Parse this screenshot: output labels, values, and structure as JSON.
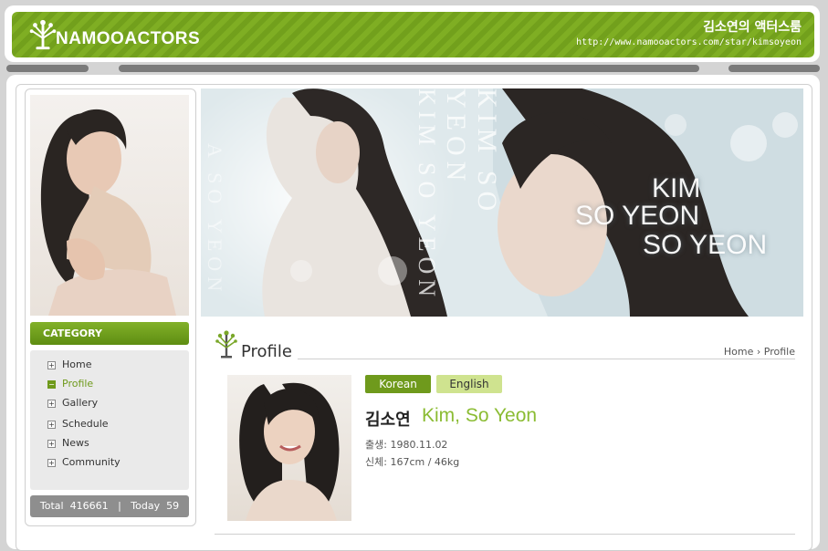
{
  "header": {
    "logo_text": "NAMOOACTORS",
    "site_title": "김소연의 액터스룸",
    "site_url": "http://www.namooactors.com/star/kimsoyeon",
    "logo_icon": "tree-icon"
  },
  "sidebar": {
    "category_title": "CATEGORY",
    "menu": [
      {
        "label": "Home",
        "active": false
      },
      {
        "label": "Profile",
        "active": true
      },
      {
        "label": "Gallery",
        "active": false
      },
      {
        "label": "Schedule",
        "active": false
      },
      {
        "label": "News",
        "active": false
      },
      {
        "label": "Community",
        "active": false
      }
    ],
    "counter": {
      "total_label": "Total",
      "total_value": "416661",
      "today_label": "Today",
      "today_value": "59"
    }
  },
  "banner": {
    "vertical_text": "KIM SO YEON",
    "vertical_text_2": "A SO YEON",
    "word_1": "KIM",
    "word_2": "SO YEON",
    "word_3": "SO YEON"
  },
  "profile": {
    "heading": "Profile",
    "breadcrumb": {
      "home": "Home",
      "separator": "›",
      "current": "Profile"
    },
    "lang_korean": "Korean",
    "lang_english": "English",
    "name_ko": "김소연",
    "name_en": "Kim, So Yeon",
    "birth_label": "출생:",
    "birth_value": "1980.11.02",
    "body_label": "신체:",
    "body_value": "167cm / 46kg"
  },
  "colors": {
    "brand_green": "#7fae23",
    "active_green": "#6f9a1c",
    "name_green": "#8bbc33",
    "button_light": "#cfe38f"
  }
}
